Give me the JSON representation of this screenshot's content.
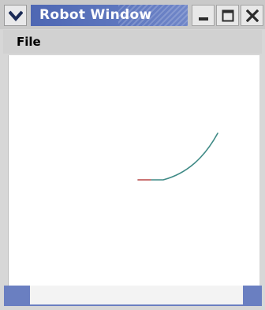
{
  "window": {
    "title": "Robot Window"
  },
  "menu": {
    "items": [
      {
        "label": "File"
      }
    ]
  },
  "icons": {
    "window_menu": "chevron-down-icon",
    "minimize": "minimize-icon",
    "maximize": "maximize-icon",
    "close": "close-icon"
  },
  "colors": {
    "title_bar": "#5a72bb",
    "robot_path": "#3f8a86",
    "path_tip": "#d85a5a"
  }
}
